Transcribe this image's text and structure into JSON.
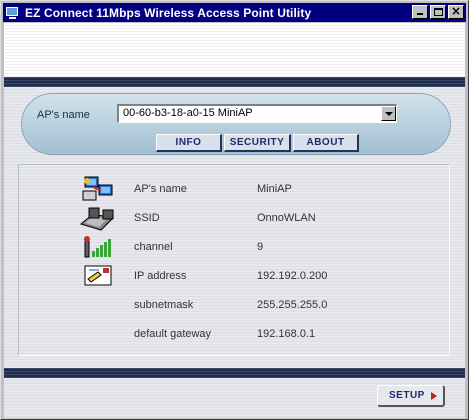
{
  "window": {
    "title": "EZ Connect 11Mbps Wireless Access Point Utility",
    "controls": {
      "minimize": "minimize",
      "maximize": "maximize",
      "close": "×"
    }
  },
  "ap_selector": {
    "label": "AP's name",
    "selected": "00-60-b3-18-a0-15  MiniAP"
  },
  "tabs": [
    {
      "label": "INFO"
    },
    {
      "label": "SECURITY"
    },
    {
      "label": "ABOUT"
    }
  ],
  "info": {
    "rows": [
      {
        "icon": "network-computers-icon",
        "label": "AP's name",
        "value": "MiniAP"
      },
      {
        "icon": "access-point-icon",
        "label": "SSID",
        "value": "OnnoWLAN"
      },
      {
        "icon": "signal-bars-icon",
        "label": "channel",
        "value": "9"
      },
      {
        "icon": "address-card-icon",
        "label": "IP address",
        "value": "192.192.0.200"
      },
      {
        "icon": "",
        "label": "subnetmask",
        "value": "255.255.255.0"
      },
      {
        "icon": "",
        "label": "default gateway",
        "value": "192.168.0.1"
      }
    ]
  },
  "footer": {
    "setup_label": "SETUP"
  },
  "colors": {
    "titlebar": "#000080",
    "tab_text": "#1d2a70",
    "setup_arrow": "#c02020",
    "signal_green": "#3aa53a"
  }
}
